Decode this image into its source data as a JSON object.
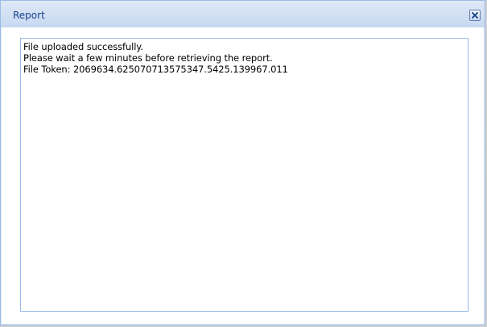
{
  "window": {
    "title": "Report",
    "close_icon": "close-icon"
  },
  "message": {
    "line1": "File uploaded successfully.",
    "line2": "Please wait a few minutes before retrieving the report.",
    "line3": "File Token: 2069634.625070713575347.5425.139967.011"
  },
  "colors": {
    "title_text": "#15428b",
    "border": "#99bbe8",
    "header_bg": "#dfe8f6"
  }
}
